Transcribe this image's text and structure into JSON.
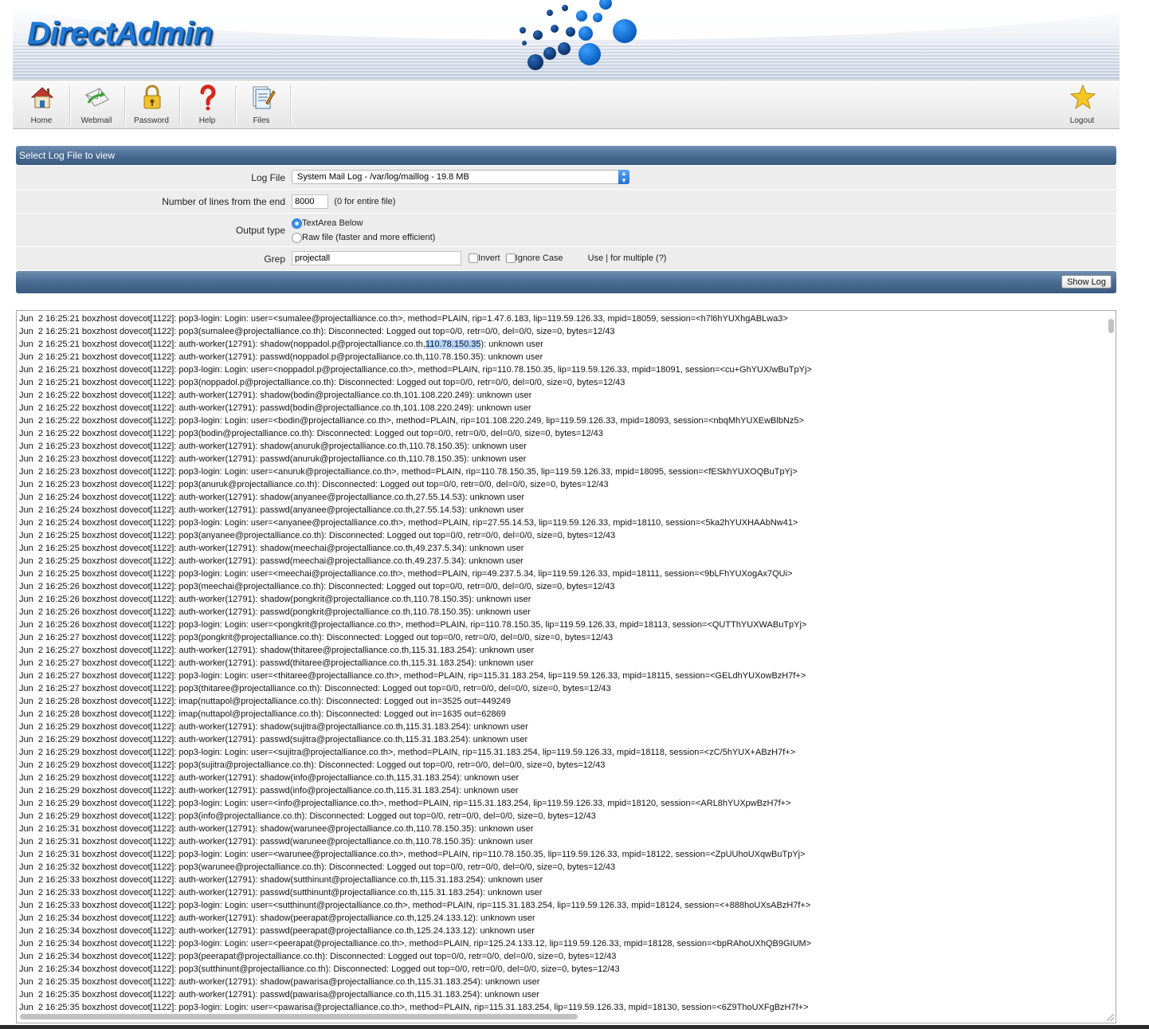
{
  "header": {
    "logo": "DirectAdmin"
  },
  "nav": {
    "items": [
      {
        "label": "Home",
        "icon": "home-icon"
      },
      {
        "label": "Webmail",
        "icon": "webmail-icon"
      },
      {
        "label": "Password",
        "icon": "lock-icon"
      },
      {
        "label": "Help",
        "icon": "help-icon"
      },
      {
        "label": "Files",
        "icon": "files-icon"
      }
    ],
    "logout": {
      "label": "Logout",
      "icon": "star-icon"
    }
  },
  "form": {
    "title": "Select Log File to view",
    "log_file_label": "Log File",
    "log_file_value": "System Mail Log - /var/log/maillog - 19.8 MB",
    "lines_label": "Number of lines from the end",
    "lines_value": "8000",
    "lines_hint": "(0 for entire file)",
    "output_label": "Output type",
    "output_option_textarea": "TextArea Below",
    "output_option_raw": "Raw file (faster and more efficient)",
    "output_selected": "TextArea Below",
    "grep_label": "Grep",
    "grep_value": "projectall",
    "invert_label": "Invert",
    "ignore_case_label": "Ignore Case",
    "grep_hint": "Use | for multiple (?)",
    "show_log_button": "Show Log"
  },
  "log": {
    "highlight": "110.78.150.35",
    "lines": [
      "Jun  2 16:25:21 boxzhost dovecot[1122]: pop3-login: Login: user=<sumalee@projectalliance.co.th>, method=PLAIN, rip=1.47.6.183, lip=119.59.126.33, mpid=18059, session=<h7l6hYUXhgABLwa3>",
      "Jun  2 16:25:21 boxzhost dovecot[1122]: pop3(sumalee@projectalliance.co.th): Disconnected: Logged out top=0/0, retr=0/0, del=0/0, size=0, bytes=12/43",
      "Jun  2 16:25:21 boxzhost dovecot[1122]: auth-worker(12791): shadow(noppadol.p@projectalliance.co.th,110.78.150.35): unknown user",
      "Jun  2 16:25:21 boxzhost dovecot[1122]: auth-worker(12791): passwd(noppadol.p@projectalliance.co.th,110.78.150.35): unknown user",
      "Jun  2 16:25:21 boxzhost dovecot[1122]: pop3-login: Login: user=<noppadol.p@projectalliance.co.th>, method=PLAIN, rip=110.78.150.35, lip=119.59.126.33, mpid=18091, session=<cu+GhYUX/wBuTpYj>",
      "Jun  2 16:25:21 boxzhost dovecot[1122]: pop3(noppadol.p@projectalliance.co.th): Disconnected: Logged out top=0/0, retr=0/0, del=0/0, size=0, bytes=12/43",
      "Jun  2 16:25:22 boxzhost dovecot[1122]: auth-worker(12791): shadow(bodin@projectalliance.co.th,101.108.220.249): unknown user",
      "Jun  2 16:25:22 boxzhost dovecot[1122]: auth-worker(12791): passwd(bodin@projectalliance.co.th,101.108.220.249): unknown user",
      "Jun  2 16:25:22 boxzhost dovecot[1122]: pop3-login: Login: user=<bodin@projectalliance.co.th>, method=PLAIN, rip=101.108.220.249, lip=119.59.126.33, mpid=18093, session=<nbqMhYUXEwBlbNz5>",
      "Jun  2 16:25:22 boxzhost dovecot[1122]: pop3(bodin@projectalliance.co.th): Disconnected: Logged out top=0/0, retr=0/0, del=0/0, size=0, bytes=12/43",
      "Jun  2 16:25:23 boxzhost dovecot[1122]: auth-worker(12791): shadow(anuruk@projectalliance.co.th,110.78.150.35): unknown user",
      "Jun  2 16:25:23 boxzhost dovecot[1122]: auth-worker(12791): passwd(anuruk@projectalliance.co.th,110.78.150.35): unknown user",
      "Jun  2 16:25:23 boxzhost dovecot[1122]: pop3-login: Login: user=<anuruk@projectalliance.co.th>, method=PLAIN, rip=110.78.150.35, lip=119.59.126.33, mpid=18095, session=<fESkhYUXOQBuTpYj>",
      "Jun  2 16:25:23 boxzhost dovecot[1122]: pop3(anuruk@projectalliance.co.th): Disconnected: Logged out top=0/0, retr=0/0, del=0/0, size=0, bytes=12/43",
      "Jun  2 16:25:24 boxzhost dovecot[1122]: auth-worker(12791): shadow(anyanee@projectalliance.co.th,27.55.14.53): unknown user",
      "Jun  2 16:25:24 boxzhost dovecot[1122]: auth-worker(12791): passwd(anyanee@projectalliance.co.th,27.55.14.53): unknown user",
      "Jun  2 16:25:24 boxzhost dovecot[1122]: pop3-login: Login: user=<anyanee@projectalliance.co.th>, method=PLAIN, rip=27.55.14.53, lip=119.59.126.33, mpid=18110, session=<5ka2hYUXHAAbNw41>",
      "Jun  2 16:25:25 boxzhost dovecot[1122]: pop3(anyanee@projectalliance.co.th): Disconnected: Logged out top=0/0, retr=0/0, del=0/0, size=0, bytes=12/43",
      "Jun  2 16:25:25 boxzhost dovecot[1122]: auth-worker(12791): shadow(meechai@projectalliance.co.th,49.237.5.34): unknown user",
      "Jun  2 16:25:25 boxzhost dovecot[1122]: auth-worker(12791): passwd(meechai@projectalliance.co.th,49.237.5.34): unknown user",
      "Jun  2 16:25:25 boxzhost dovecot[1122]: pop3-login: Login: user=<meechai@projectalliance.co.th>, method=PLAIN, rip=49.237.5.34, lip=119.59.126.33, mpid=18111, session=<9bLFhYUXogAx7QUi>",
      "Jun  2 16:25:26 boxzhost dovecot[1122]: pop3(meechai@projectalliance.co.th): Disconnected: Logged out top=0/0, retr=0/0, del=0/0, size=0, bytes=12/43",
      "Jun  2 16:25:26 boxzhost dovecot[1122]: auth-worker(12791): shadow(pongkrit@projectalliance.co.th,110.78.150.35): unknown user",
      "Jun  2 16:25:26 boxzhost dovecot[1122]: auth-worker(12791): passwd(pongkrit@projectalliance.co.th,110.78.150.35): unknown user",
      "Jun  2 16:25:26 boxzhost dovecot[1122]: pop3-login: Login: user=<pongkrit@projectalliance.co.th>, method=PLAIN, rip=110.78.150.35, lip=119.59.126.33, mpid=18113, session=<QUTThYUXWABuTpYj>",
      "Jun  2 16:25:27 boxzhost dovecot[1122]: pop3(pongkrit@projectalliance.co.th): Disconnected: Logged out top=0/0, retr=0/0, del=0/0, size=0, bytes=12/43",
      "Jun  2 16:25:27 boxzhost dovecot[1122]: auth-worker(12791): shadow(thitaree@projectalliance.co.th,115.31.183.254): unknown user",
      "Jun  2 16:25:27 boxzhost dovecot[1122]: auth-worker(12791): passwd(thitaree@projectalliance.co.th,115.31.183.254): unknown user",
      "Jun  2 16:25:27 boxzhost dovecot[1122]: pop3-login: Login: user=<thitaree@projectalliance.co.th>, method=PLAIN, rip=115.31.183.254, lip=119.59.126.33, mpid=18115, session=<GELdhYUXowBzH7f+>",
      "Jun  2 16:25:27 boxzhost dovecot[1122]: pop3(thitaree@projectalliance.co.th): Disconnected: Logged out top=0/0, retr=0/0, del=0/0, size=0, bytes=12/43",
      "Jun  2 16:25:28 boxzhost dovecot[1122]: imap(nuttapol@projectalliance.co.th): Disconnected: Logged out in=3525 out=449249",
      "Jun  2 16:25:28 boxzhost dovecot[1122]: imap(nuttapol@projectalliance.co.th): Disconnected: Logged out in=1635 out=62869",
      "Jun  2 16:25:29 boxzhost dovecot[1122]: auth-worker(12791): shadow(sujitra@projectalliance.co.th,115.31.183.254): unknown user",
      "Jun  2 16:25:29 boxzhost dovecot[1122]: auth-worker(12791): passwd(sujitra@projectalliance.co.th,115.31.183.254): unknown user",
      "Jun  2 16:25:29 boxzhost dovecot[1122]: pop3-login: Login: user=<sujitra@projectalliance.co.th>, method=PLAIN, rip=115.31.183.254, lip=119.59.126.33, mpid=18118, session=<zC/5hYUX+ABzH7f+>",
      "Jun  2 16:25:29 boxzhost dovecot[1122]: pop3(sujitra@projectalliance.co.th): Disconnected: Logged out top=0/0, retr=0/0, del=0/0, size=0, bytes=12/43",
      "Jun  2 16:25:29 boxzhost dovecot[1122]: auth-worker(12791): shadow(info@projectalliance.co.th,115.31.183.254): unknown user",
      "Jun  2 16:25:29 boxzhost dovecot[1122]: auth-worker(12791): passwd(info@projectalliance.co.th,115.31.183.254): unknown user",
      "Jun  2 16:25:29 boxzhost dovecot[1122]: pop3-login: Login: user=<info@projectalliance.co.th>, method=PLAIN, rip=115.31.183.254, lip=119.59.126.33, mpid=18120, session=<ARL8hYUXpwBzH7f+>",
      "Jun  2 16:25:29 boxzhost dovecot[1122]: pop3(info@projectalliance.co.th): Disconnected: Logged out top=0/0, retr=0/0, del=0/0, size=0, bytes=12/43",
      "Jun  2 16:25:31 boxzhost dovecot[1122]: auth-worker(12791): shadow(warunee@projectalliance.co.th,110.78.150.35): unknown user",
      "Jun  2 16:25:31 boxzhost dovecot[1122]: auth-worker(12791): passwd(warunee@projectalliance.co.th,110.78.150.35): unknown user",
      "Jun  2 16:25:31 boxzhost dovecot[1122]: pop3-login: Login: user=<warunee@projectalliance.co.th>, method=PLAIN, rip=110.78.150.35, lip=119.59.126.33, mpid=18122, session=<ZpUUhoUXqwBuTpYj>",
      "Jun  2 16:25:32 boxzhost dovecot[1122]: pop3(warunee@projectalliance.co.th): Disconnected: Logged out top=0/0, retr=0/0, del=0/0, size=0, bytes=12/43",
      "Jun  2 16:25:33 boxzhost dovecot[1122]: auth-worker(12791): shadow(sutthinunt@projectalliance.co.th,115.31.183.254): unknown user",
      "Jun  2 16:25:33 boxzhost dovecot[1122]: auth-worker(12791): passwd(sutthinunt@projectalliance.co.th,115.31.183.254): unknown user",
      "Jun  2 16:25:33 boxzhost dovecot[1122]: pop3-login: Login: user=<sutthinunt@projectalliance.co.th>, method=PLAIN, rip=115.31.183.254, lip=119.59.126.33, mpid=18124, session=<+888hoUXsABzH7f+>",
      "Jun  2 16:25:34 boxzhost dovecot[1122]: auth-worker(12791): shadow(peerapat@projectalliance.co.th,125.24.133.12): unknown user",
      "Jun  2 16:25:34 boxzhost dovecot[1122]: auth-worker(12791): passwd(peerapat@projectalliance.co.th,125.24.133.12): unknown user",
      "Jun  2 16:25:34 boxzhost dovecot[1122]: pop3-login: Login: user=<peerapat@projectalliance.co.th>, method=PLAIN, rip=125.24.133.12, lip=119.59.126.33, mpid=18128, session=<bpRAhoUXhQB9GIUM>",
      "Jun  2 16:25:34 boxzhost dovecot[1122]: pop3(peerapat@projectalliance.co.th): Disconnected: Logged out top=0/0, retr=0/0, del=0/0, size=0, bytes=12/43",
      "Jun  2 16:25:34 boxzhost dovecot[1122]: pop3(sutthinunt@projectalliance.co.th): Disconnected: Logged out top=0/0, retr=0/0, del=0/0, size=0, bytes=12/43",
      "Jun  2 16:25:35 boxzhost dovecot[1122]: auth-worker(12791): shadow(pawarisa@projectalliance.co.th,115.31.183.254): unknown user",
      "Jun  2 16:25:35 boxzhost dovecot[1122]: auth-worker(12791): passwd(pawarisa@projectalliance.co.th,115.31.183.254): unknown user",
      "Jun  2 16:25:35 boxzhost dovecot[1122]: pop3-login: Login: user=<pawarisa@projectalliance.co.th>, method=PLAIN, rip=115.31.183.254, lip=119.59.126.33, mpid=18130, session=<6Z9ThoUXFgBzH7f+>"
    ]
  }
}
